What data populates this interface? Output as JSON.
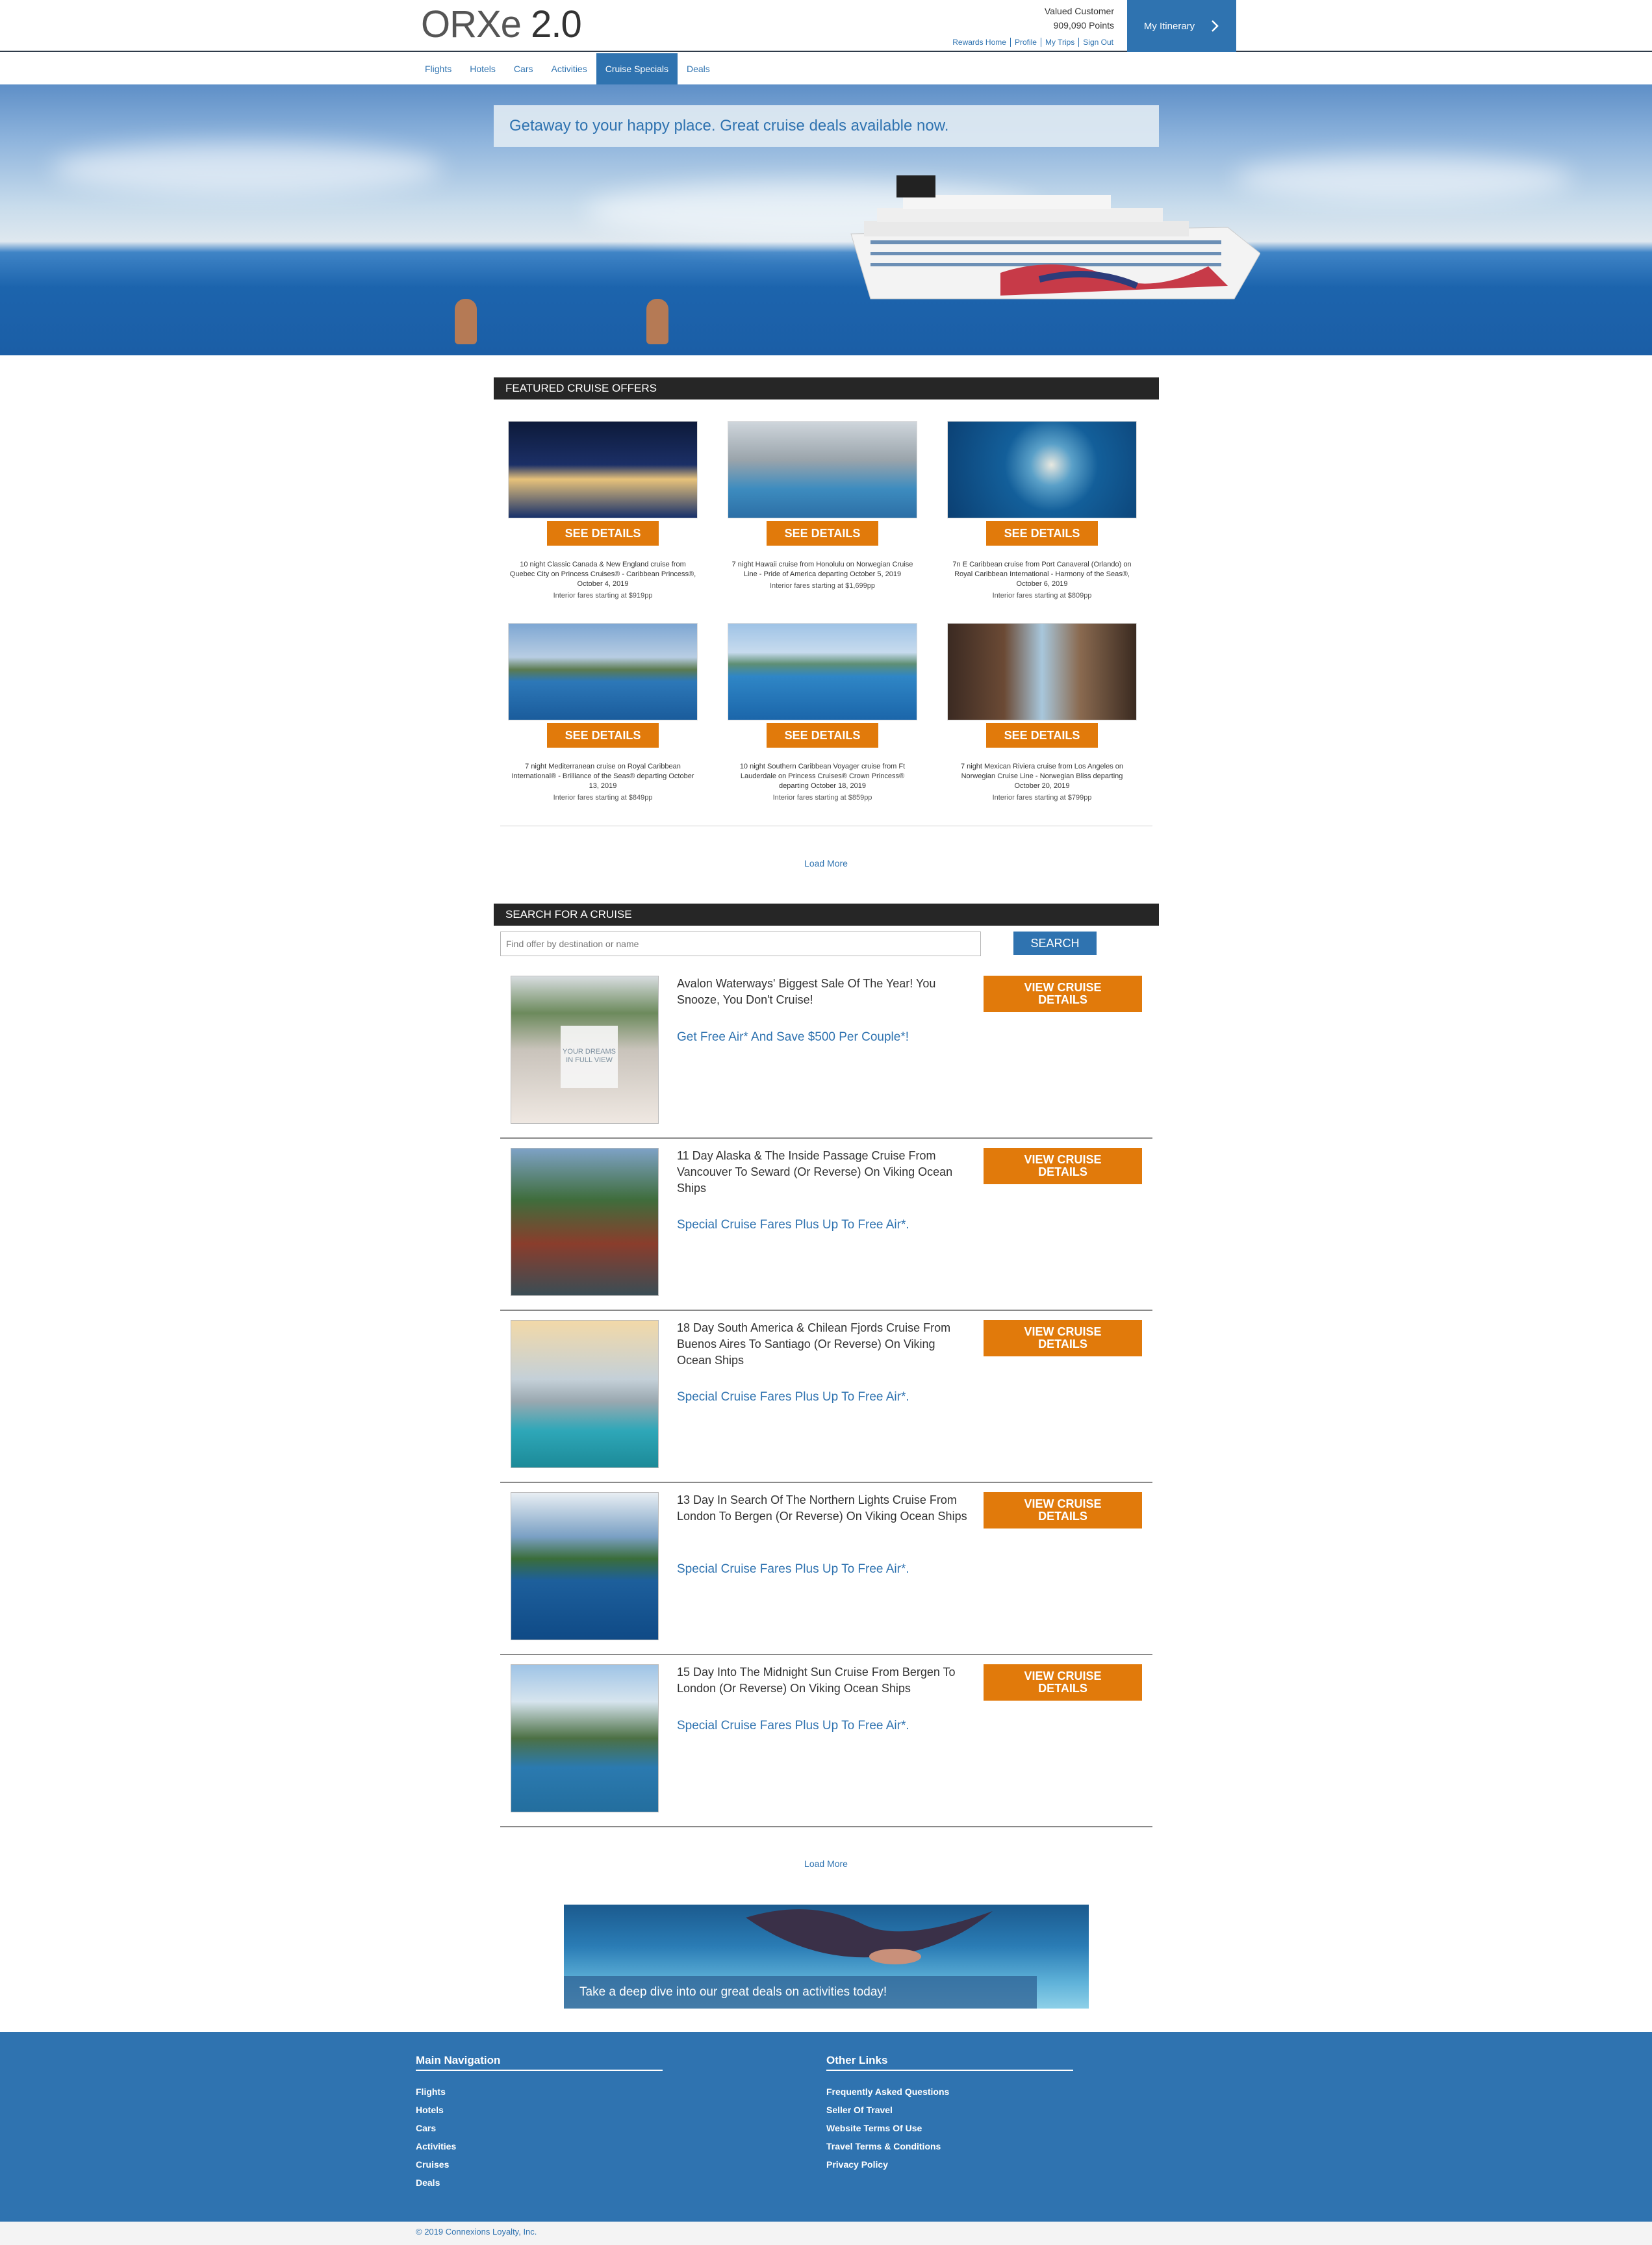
{
  "header": {
    "logo_thin": "ORXe",
    "logo_version": "2.0",
    "user_name": "Valued Customer",
    "points": "909,090 Points",
    "links": [
      "Rewards Home",
      "Profile",
      "My Trips",
      "Sign Out"
    ],
    "itinerary_label": "My Itinerary"
  },
  "nav": {
    "items": [
      "Flights",
      "Hotels",
      "Cars",
      "Activities",
      "Cruise Specials",
      "Deals"
    ],
    "active": "Cruise Specials"
  },
  "hero": {
    "banner_text": "Getaway to your happy place. Great cruise deals available now."
  },
  "featured": {
    "heading": "Featured Cruise Offers",
    "button_label": "See Details",
    "offers": [
      {
        "desc": "10 night Classic Canada & New England cruise from Quebec City on Princess Cruises® - Caribbean Princess®, October 4, 2019",
        "price": "Interior fares starting at $919pp"
      },
      {
        "desc": "7 night Hawaii cruise from Honolulu on Norwegian Cruise Line - Pride of America departing October 5, 2019",
        "price": "Interior fares starting at $1,699pp"
      },
      {
        "desc": "7n E Caribbean cruise from Port Canaveral (Orlando) on Royal Caribbean International - Harmony of the Seas®, October 6, 2019",
        "price": "Interior fares starting at $809pp"
      },
      {
        "desc": "7 night Mediterranean cruise on Royal Caribbean International® - Brilliance of the Seas® departing October 13, 2019",
        "price": "Interior fares starting at $849pp"
      },
      {
        "desc": "10 night Southern Caribbean Voyager cruise from Ft Lauderdale on Princess Cruises® Crown Princess® departing October 18, 2019",
        "price": "Interior fares starting at $859pp"
      },
      {
        "desc": "7 night Mexican Riviera cruise from Los Angeles on Norwegian Cruise Line - Norwegian Bliss departing October 20, 2019",
        "price": "Interior fares starting at $799pp"
      }
    ],
    "load_more": "Load More"
  },
  "search": {
    "heading": "Search For A Cruise",
    "placeholder": "Find offer by destination or name",
    "button_label": "SEARCH",
    "view_label": "View Cruise Details",
    "results": [
      {
        "title": "Avalon Waterways' Biggest Sale Of The Year! You Snooze, You Don't Cruise!",
        "link": "Get Free Air* And Save $500 Per Couple*!",
        "img_text_1": "YOUR DREAMS",
        "img_text_2": "IN FULL VIEW"
      },
      {
        "title": "11 Day Alaska & The Inside Passage Cruise From Vancouver To Seward (Or Reverse) On Viking Ocean Ships",
        "link": "Special Cruise Fares Plus Up To Free Air*."
      },
      {
        "title": "18 Day South America & Chilean Fjords Cruise From Buenos Aires To Santiago (Or Reverse) On Viking Ocean Ships",
        "link": "Special Cruise Fares Plus Up To Free Air*."
      },
      {
        "title": "13 Day In Search Of The Northern Lights Cruise From London To Bergen (Or Reverse) On Viking Ocean Ships",
        "link": "Special Cruise Fares Plus Up To Free Air*."
      },
      {
        "title": "15 Day Into The Midnight Sun Cruise From Bergen To London (Or Reverse) On Viking Ocean Ships",
        "link": "Special Cruise Fares Plus Up To Free Air*."
      }
    ],
    "load_more": "Load More"
  },
  "promo": {
    "caption": "Take a deep dive into our great deals on activities today!"
  },
  "footer": {
    "main_heading": "Main Navigation",
    "main_links": [
      "Flights",
      "Hotels",
      "Cars",
      "Activities",
      "Cruises",
      "Deals"
    ],
    "other_heading": "Other Links",
    "other_links": [
      "Frequently Asked Questions",
      "Seller Of Travel",
      "Website Terms Of Use",
      "Travel Terms & Conditions",
      "Privacy Policy"
    ],
    "copyright": "© 2019 Connexions Loyalty, Inc."
  },
  "colors": {
    "brand_blue": "#2f73b0",
    "accent_orange": "#e17a0b",
    "section_dark": "#262626"
  }
}
